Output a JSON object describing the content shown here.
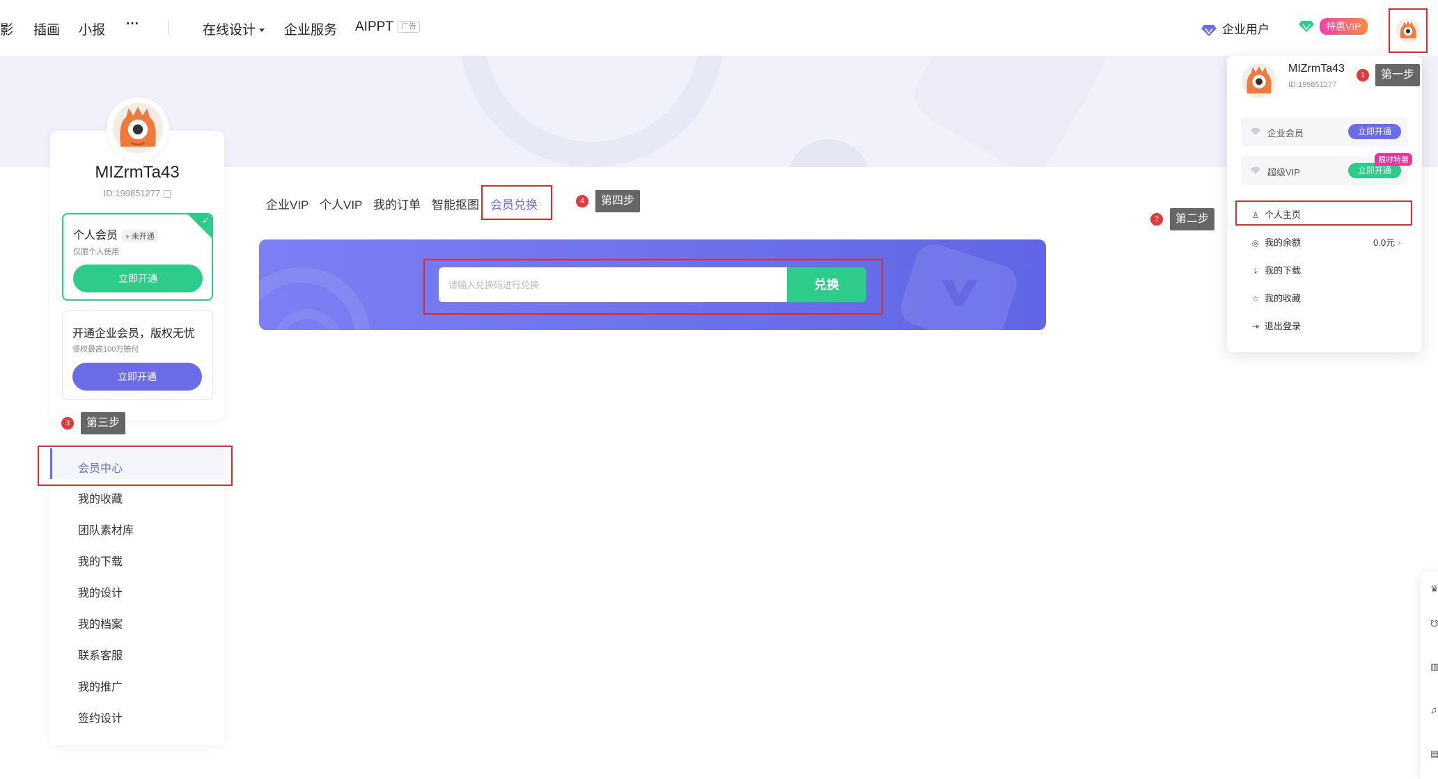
{
  "nav": {
    "items": [
      "影",
      "插画",
      "小报",
      "···",
      "在线设计",
      "企业服务",
      "AIPPT"
    ],
    "ad_tag": "广告"
  },
  "topright": {
    "enterprise": "企业用户",
    "vip": "特惠VIP"
  },
  "profile": {
    "name": "MIZrmTa43",
    "id": "ID:199851277",
    "personal_member": {
      "title": "个人会员",
      "status": "未开通",
      "sub": "仅限个人使用",
      "button": "立即开通"
    },
    "enterprise_member": {
      "title": "开通企业会员，版权无忧",
      "sub": "侵权最高100万赔付",
      "button": "立即开通"
    }
  },
  "menu": {
    "items": [
      "会员中心",
      "我的收藏",
      "团队素材库",
      "我的下载",
      "我的设计",
      "我的档案",
      "联系客服",
      "我的推广",
      "签约设计"
    ],
    "active": "会员中心"
  },
  "tabs": [
    "企业VIP",
    "个人VIP",
    "我的订单",
    "智能抠图",
    "会员兑换"
  ],
  "redeem": {
    "placeholder": "请输入兑换码进行兑换",
    "button": "兑换"
  },
  "dropdown": {
    "name": "MIZrmTa43",
    "id": "ID:199851277",
    "enterprise": {
      "label": "企业会员",
      "button": "立即开通"
    },
    "super_vip": {
      "label": "超级VIP",
      "button": "立即开通",
      "tag": "限时特惠"
    },
    "items": [
      "个人主页",
      "我的余额",
      "我的下载",
      "我的收藏",
      "退出登录"
    ],
    "balance": "0.0元"
  },
  "steps": {
    "s1": {
      "num": "1",
      "text": "第一步"
    },
    "s2": {
      "num": "2",
      "text": "第二步"
    },
    "s3": {
      "num": "3",
      "text": "第三步"
    },
    "s4": {
      "num": "4",
      "text": "第四步"
    }
  },
  "colors": {
    "accent": "#6a6ce8",
    "green": "#2ecc8a",
    "annotation_red": "#e02b2b"
  }
}
